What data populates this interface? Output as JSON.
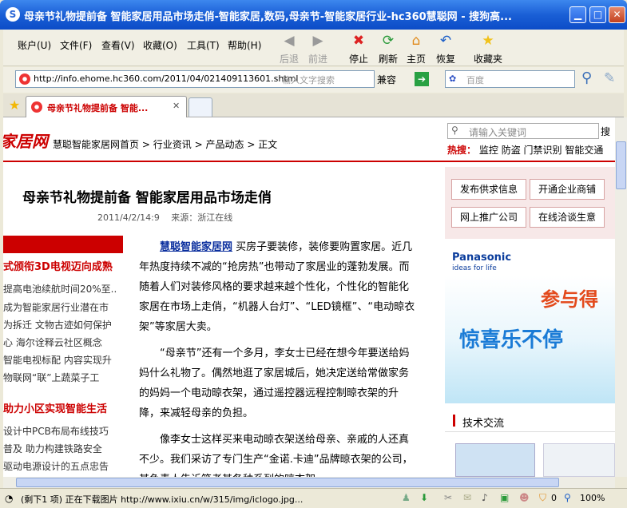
{
  "window": {
    "icon": "S",
    "title": "母亲节礼物提前备 智能家居用品市场走俏-智能家居,数码,母亲节-智能家居行业-hc360慧聪网 - 搜狗高...",
    "min": "▁",
    "max": "□",
    "close": "✕"
  },
  "menu": [
    "账户(U)",
    "文件(F)",
    "查看(V)",
    "收藏(O)",
    "工具(T)",
    "帮助(H)"
  ],
  "toolbar": {
    "back": "后退",
    "forward": "前进",
    "stop": "停止",
    "refresh": "刷新",
    "home": "主页",
    "restore": "恢复",
    "favorites": "收藏夹"
  },
  "address": {
    "url": "http://info.ehome.hc360.com/2011/04/021409113601.shtml",
    "search_hint": "输入文字搜索",
    "compat": "兼容",
    "search_placeholder": "百度"
  },
  "tabs": [
    {
      "label": "母亲节礼物提前备 智能...",
      "close": "✕"
    }
  ],
  "site": {
    "logo": "家居网",
    "breadcrumb": [
      "慧聪智能家居网首页",
      ">",
      "行业资讯",
      ">",
      "产品动态",
      ">",
      "正文"
    ],
    "search_placeholder": "请输入关键词",
    "search_btn": "搜",
    "hot_label": "热搜：",
    "hot": [
      "监控",
      "防盗",
      "门禁识别",
      "智能交通"
    ]
  },
  "article": {
    "title": "母亲节礼物提前备 智能家居用品市场走俏",
    "meta": "2011/4/2/14:9 　来源：浙江在线",
    "lead_link": "慧聪智能家居网",
    "p1": "买房子要装修，装修要购置家居。近几年热度持续不减的“抢房热”也带动了家居业的蓬勃发展。而随着人们对装修风格的要求越来越个性化，个性化的智能化家居在市场上走俏，“机器人台灯”、“LED镜框”、“电动晾衣架”等家居大卖。",
    "p2": "“母亲节”还有一个多月，李女士已经在想今年要送给妈妈什么礼物了。偶然地逛了家居城后，她决定送给常做家务的妈妈一个电动晾衣架，通过遥控器远程控制晾衣架的升降，来减轻母亲的负担。",
    "p3": "像李女士这样买来电动晾衣架送给母亲、亲戚的人还真不少。我们采访了专门生产“金诺.卡迪”品牌晾衣架的公司，其负责人告诉笔者其各种系列的晾衣架"
  },
  "sidebar": {
    "head1": "式颁衔3D电视迈向成熟",
    "items1": [
      "提高电池续航时间20%至..",
      "成为智能家居行业潜在市",
      "为拆迁 文物古迹如何保护",
      "心 海尔诠释云社区概念",
      "智能电视标配 内容实现升",
      "物联网“联”上蔬菜子工"
    ],
    "head2": "助力小区实现智能生活",
    "items2": [
      "设计中PCB布局布线技巧",
      "普及 助力构建铁路安全",
      "驱动电源设计的五点忠告"
    ]
  },
  "right": {
    "buttons": [
      "发布供求信息",
      "开通企业商铺",
      "网上推广公司",
      "在线洽谈生意"
    ],
    "ad_brand": "Panasonic",
    "ad_tag": "ideas for life",
    "ad_text1": "参与得",
    "ad_text2": "惊喜乐不停",
    "tech": "技术交流"
  },
  "status": {
    "text": "(剩下1 项) 正在下载图片 http://www.ixiu.cn/w/315/img/iclogo.jpg...",
    "count": "0",
    "zoom": "100%"
  },
  "colors": {
    "accent": "#c00000",
    "title_blue": "#0c4cc7"
  }
}
